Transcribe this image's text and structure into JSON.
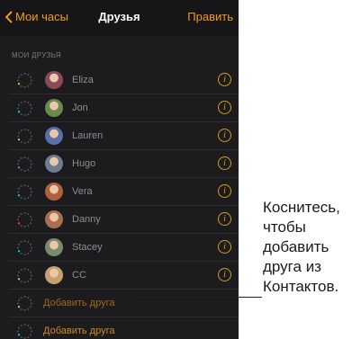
{
  "navbar": {
    "back_label": "Мои часы",
    "title": "Друзья",
    "edit_label": "Править"
  },
  "section_header": "МОИ ДРУЗЬЯ",
  "friends": [
    {
      "name": "Eliza",
      "avatar_color": "#8a4a5c"
    },
    {
      "name": "Jon",
      "avatar_color": "#6b8a4e"
    },
    {
      "name": "Lauren",
      "avatar_color": "#5a6fa8"
    },
    {
      "name": "Hugo",
      "avatar_color": "#6e7c8e"
    },
    {
      "name": "Vera",
      "avatar_color": "#b0603c"
    },
    {
      "name": "Danny",
      "avatar_color": "#a87050"
    },
    {
      "name": "Stacey",
      "avatar_color": "#7a8a6c"
    },
    {
      "name": "CC",
      "avatar_color": "#c8a070"
    }
  ],
  "add_friend_dim": "Добавить друга",
  "add_friend": "Добавить друга",
  "callout": "Коснитесь, чтобы добавить друга из Контактов.",
  "colors": {
    "accent": "#f39a1c",
    "background": "#1c1c1e"
  }
}
